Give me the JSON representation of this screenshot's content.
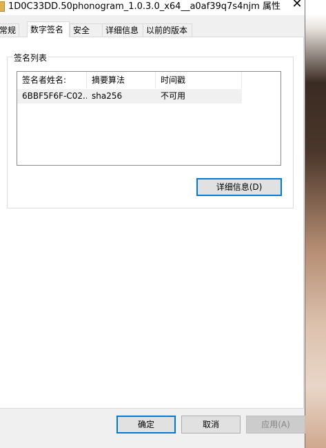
{
  "window": {
    "title": "1D0C33DD.50phonogram_1.0.3.0_x64__a0af39q7s4njm 属性",
    "close_symbol": "✕"
  },
  "tabs": [
    {
      "label": "常规",
      "active": false
    },
    {
      "label": "数字签名",
      "active": true
    },
    {
      "label": "安全",
      "active": false
    },
    {
      "label": "详细信息",
      "active": false
    },
    {
      "label": "以前的版本",
      "active": false
    }
  ],
  "signature_group": {
    "label": "签名列表",
    "columns": [
      "签名者姓名:",
      "摘要算法",
      "时间戳"
    ],
    "rows": [
      [
        "6BBF5F6F-C02...",
        "sha256",
        "不可用"
      ]
    ],
    "details_button": "详细信息(D)"
  },
  "footer": {
    "ok": "确定",
    "cancel": "取消",
    "apply": "应用(A)"
  },
  "icons": {
    "title_icon": "folder-icon",
    "close_icon": "close-icon"
  },
  "colors": {
    "focus_border": "#0078d7",
    "disabled_text": "#838383"
  }
}
